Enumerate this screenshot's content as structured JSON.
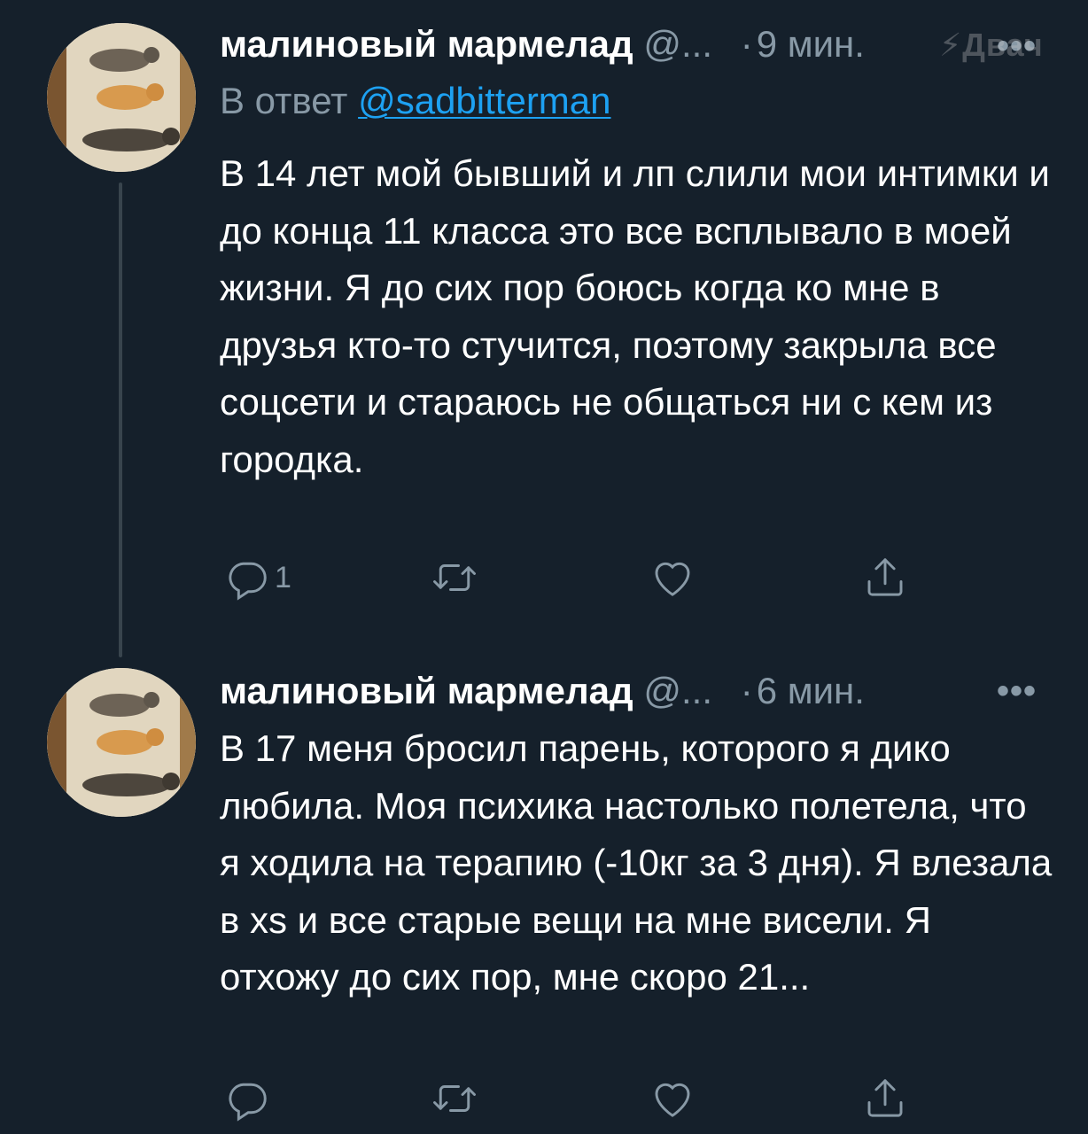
{
  "tweets": [
    {
      "name": "малиновый мармелад",
      "handle": "@...",
      "time": "9 мин.",
      "more": "•••",
      "reply_prefix": "В ответ",
      "reply_handle": "@sadbitterman",
      "text": "В 14 лет мой бывший и лп слили мои интимки и до конца 11 класса это все всплывало в моей жизни. Я до сих пор боюсь когда ко мне в друзья кто-то стучится, поэтому закрыла все соцсети и стараюсь не общаться ни с кем из городка.",
      "reply_count": "1"
    },
    {
      "name": "малиновый мармелад",
      "handle": "@...",
      "time": "6 мин.",
      "more": "•••",
      "text": "В 17 меня бросил парень, которого я дико любила. Моя психика настолько полетела, что я ходила на терапию (-10кг за 3 дня). Я влезала в xs и все старые вещи на мне висели. Я отхожу до сих пор, мне скоро 21...",
      "reply_count": ""
    }
  ],
  "watermark": "Двач",
  "icons": [
    "reply-icon",
    "retweet-icon",
    "like-icon",
    "share-icon",
    "more-icon"
  ],
  "colors": {
    "background": "#15202b",
    "secondary_text": "#8899a6",
    "link": "#1da1f2",
    "thread_line": "#38444d"
  }
}
